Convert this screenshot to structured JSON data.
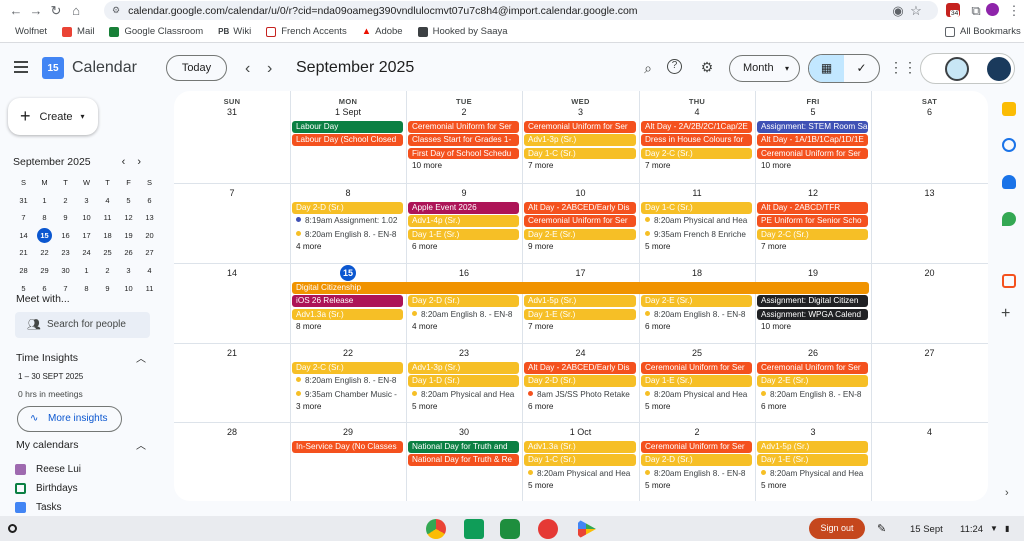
{
  "browser": {
    "url": "calendar.google.com/calendar/u/0/r?cid=nda09oameg390vndlulocmvt07u7c8h4@import.calendar.google.com",
    "bookmarks": [
      "Wolfnet",
      "Mail",
      "Google Classroom",
      "Wiki",
      "French Accents",
      "Adobe",
      "Hooked by Saaya"
    ],
    "all_bookmarks": "All Bookmarks",
    "ext_badge": "34"
  },
  "app": {
    "name": "Calendar",
    "logo_day": "15",
    "today": "Today",
    "month_title": "September 2025",
    "view": "Month"
  },
  "sidebar": {
    "create": "Create",
    "mini_title": "September 2025",
    "mini_dow": [
      "S",
      "M",
      "T",
      "W",
      "T",
      "F",
      "S"
    ],
    "mini_days": [
      "31",
      "1",
      "2",
      "3",
      "4",
      "5",
      "6",
      "7",
      "8",
      "9",
      "10",
      "11",
      "12",
      "13",
      "14",
      "15",
      "16",
      "17",
      "18",
      "19",
      "20",
      "21",
      "22",
      "23",
      "24",
      "25",
      "26",
      "27",
      "28",
      "29",
      "30",
      "1",
      "2",
      "3",
      "4",
      "5",
      "6",
      "7",
      "8",
      "9",
      "10",
      "11"
    ],
    "meet_with": "Meet with...",
    "search_people": "Search for people",
    "time_insights": "Time Insights",
    "date_range": "1 – 30 SEPT 2025",
    "hours": "0 hrs in meetings",
    "more_insights": "More insights",
    "my_calendars": "My calendars",
    "calendars": [
      {
        "name": "Reese Lui",
        "color": "#9e69af"
      },
      {
        "name": "Birthdays",
        "color": "#0b8043"
      },
      {
        "name": "Tasks",
        "color": "#4285f4"
      }
    ]
  },
  "grid": {
    "dow": [
      "SUN",
      "MON",
      "TUE",
      "WED",
      "THU",
      "FRI",
      "SAT"
    ],
    "weeks": [
      {
        "days": [
          "31",
          "1 Sept",
          "2",
          "3",
          "4",
          "5",
          "6"
        ],
        "ev": [
          [],
          [
            {
              "t": "Labour Day",
              "c": "g"
            },
            {
              "t": "Labour Day (School Closed",
              "c": "r"
            }
          ],
          [
            {
              "t": "Ceremonial Uniform for Ser",
              "c": "r"
            },
            {
              "t": "Classes Start for Grades 1-",
              "c": "r"
            },
            {
              "t": "First Day of School Schedu",
              "c": "r"
            },
            {
              "m": "10 more"
            }
          ],
          [
            {
              "t": "Ceremonial Uniform for Ser",
              "c": "r"
            },
            {
              "t": "Adv1-3p (Sr.)",
              "c": "y"
            },
            {
              "t": "Day 1-C (Sr.)",
              "c": "y"
            },
            {
              "m": "7 more"
            }
          ],
          [
            {
              "t": "Alt Day - 2A/2B/2C/1Cap/2E",
              "c": "r"
            },
            {
              "t": "Dress in House Colours for",
              "c": "r"
            },
            {
              "t": "Day 2-C (Sr.)",
              "c": "y"
            },
            {
              "m": "7 more"
            }
          ],
          [
            {
              "t": "Assignment: STEM Room Sa",
              "c": "b"
            },
            {
              "t": "Alt Day - 1A/1B/1Cap/1D/1E",
              "c": "r"
            },
            {
              "t": "Ceremonial Uniform for Ser",
              "c": "r"
            },
            {
              "m": "10 more"
            }
          ],
          []
        ]
      },
      {
        "days": [
          "7",
          "8",
          "9",
          "10",
          "11",
          "12",
          "13"
        ],
        "ev": [
          [],
          [
            {
              "t": "Day 2-D (Sr.)",
              "c": "y"
            },
            {
              "d": "8:19am Assignment: 1.02",
              "col": "#3f51b5"
            },
            {
              "d": "8:20am English 8. - EN-8",
              "col": "#f6bf26"
            },
            {
              "m": "4 more"
            }
          ],
          [
            {
              "t": "Apple Event 2026",
              "c": "p"
            },
            {
              "t": "Adv1-4p (Sr.)",
              "c": "y"
            },
            {
              "t": "Day 1-E (Sr.)",
              "c": "y"
            },
            {
              "m": "6 more"
            }
          ],
          [
            {
              "t": "Alt Day - 2ABCED/Early Dis",
              "c": "r"
            },
            {
              "t": "Ceremonial Uniform for Ser",
              "c": "r"
            },
            {
              "t": "Day 2-E (Sr.)",
              "c": "y"
            },
            {
              "m": "9 more"
            }
          ],
          [
            {
              "t": "Day 1-C (Sr.)",
              "c": "y"
            },
            {
              "d": "8:20am Physical and Hea",
              "col": "#f6bf26"
            },
            {
              "d": "9:35am French 8 Enriche",
              "col": "#f6bf26"
            },
            {
              "m": "5 more"
            }
          ],
          [
            {
              "t": "Alt Day - 2ABCD/TFR",
              "c": "r"
            },
            {
              "t": "PE Uniform for Senior Scho",
              "c": "r"
            },
            {
              "t": "Day 2-C (Sr.)",
              "c": "y"
            },
            {
              "m": "7 more"
            }
          ],
          []
        ]
      },
      {
        "days": [
          "14",
          "15",
          "16",
          "17",
          "18",
          "19",
          "20"
        ],
        "span": "Digital Citizenship",
        "ev": [
          [],
          [
            {
              "t": "iOS 26 Release",
              "c": "p"
            },
            {
              "t": "Adv1.3a (Sr.)",
              "c": "y"
            },
            {
              "m": "8 more"
            }
          ],
          [
            {
              "t": "Day 2-D (Sr.)",
              "c": "y"
            },
            {
              "d": "8:20am English 8. - EN-8",
              "col": "#f6bf26"
            },
            {
              "m": "4 more"
            }
          ],
          [
            {
              "t": "Adv1-5p (Sr.)",
              "c": "y"
            },
            {
              "t": "Day 1-E (Sr.)",
              "c": "y"
            },
            {
              "m": "7 more"
            }
          ],
          [
            {
              "t": "Day 2-E (Sr.)",
              "c": "y"
            },
            {
              "d": "8:20am English 8. - EN-8",
              "col": "#f6bf26"
            },
            {
              "m": "6 more"
            }
          ],
          [
            {
              "t": "Assignment: Digital Citizen",
              "c": "blk"
            },
            {
              "t": "Assignment: WPGA Calend",
              "c": "blk"
            },
            {
              "m": "10 more"
            }
          ],
          []
        ]
      },
      {
        "days": [
          "21",
          "22",
          "23",
          "24",
          "25",
          "26",
          "27"
        ],
        "ev": [
          [],
          [
            {
              "t": "Day 2-C (Sr.)",
              "c": "y"
            },
            {
              "d": "8:20am English 8. - EN-8",
              "col": "#f6bf26"
            },
            {
              "d": "9:35am Chamber Music -",
              "col": "#f6bf26"
            },
            {
              "m": "3 more"
            }
          ],
          [
            {
              "t": "Adv1-3p (Sr.)",
              "c": "y"
            },
            {
              "t": "Day 1-D (Sr.)",
              "c": "y"
            },
            {
              "d": "8:20am Physical and Hea",
              "col": "#f6bf26"
            },
            {
              "m": "5 more"
            }
          ],
          [
            {
              "t": "Alt Day - 2ABCED/Early Dis",
              "c": "r"
            },
            {
              "t": "Day 2-D (Sr.)",
              "c": "y"
            },
            {
              "d": "8am JS/SS Photo Retake",
              "col": "#f4511e"
            },
            {
              "m": "6 more"
            }
          ],
          [
            {
              "t": "Ceremonial Uniform for Ser",
              "c": "r"
            },
            {
              "t": "Day 1-E (Sr.)",
              "c": "y"
            },
            {
              "d": "8:20am Physical and Hea",
              "col": "#f6bf26"
            },
            {
              "m": "5 more"
            }
          ],
          [
            {
              "t": "Ceremonial Uniform for Ser",
              "c": "r"
            },
            {
              "t": "Day 2-E (Sr.)",
              "c": "y"
            },
            {
              "d": "8:20am English 8. - EN-8",
              "col": "#f6bf26"
            },
            {
              "m": "6 more"
            }
          ],
          []
        ]
      },
      {
        "days": [
          "28",
          "29",
          "30",
          "1 Oct",
          "2",
          "3",
          "4"
        ],
        "ev": [
          [],
          [
            {
              "t": "In-Service Day (No Classes",
              "c": "r"
            }
          ],
          [
            {
              "t": "National Day for Truth and",
              "c": "g"
            },
            {
              "t": "National Day for Truth & Re",
              "c": "r"
            }
          ],
          [
            {
              "t": "Adv1.3a (Sr.)",
              "c": "y"
            },
            {
              "t": "Day 1-C (Sr.)",
              "c": "y"
            },
            {
              "d": "8:20am Physical and Hea",
              "col": "#f6bf26"
            },
            {
              "m": "5 more"
            }
          ],
          [
            {
              "t": "Ceremonial Uniform for Ser",
              "c": "r"
            },
            {
              "t": "Day 2-D (Sr.)",
              "c": "y"
            },
            {
              "d": "8:20am English 8. - EN-8",
              "col": "#f6bf26"
            },
            {
              "m": "5 more"
            }
          ],
          [
            {
              "t": "Adv1-5p (Sr.)",
              "c": "y"
            },
            {
              "t": "Day 1-E (Sr.)",
              "c": "y"
            },
            {
              "d": "8:20am Physical and Hea",
              "col": "#f6bf26"
            },
            {
              "m": "5 more"
            }
          ],
          []
        ]
      }
    ]
  },
  "shelf": {
    "sign_out": "Sign out",
    "date": "15 Sept",
    "time": "11:24"
  }
}
